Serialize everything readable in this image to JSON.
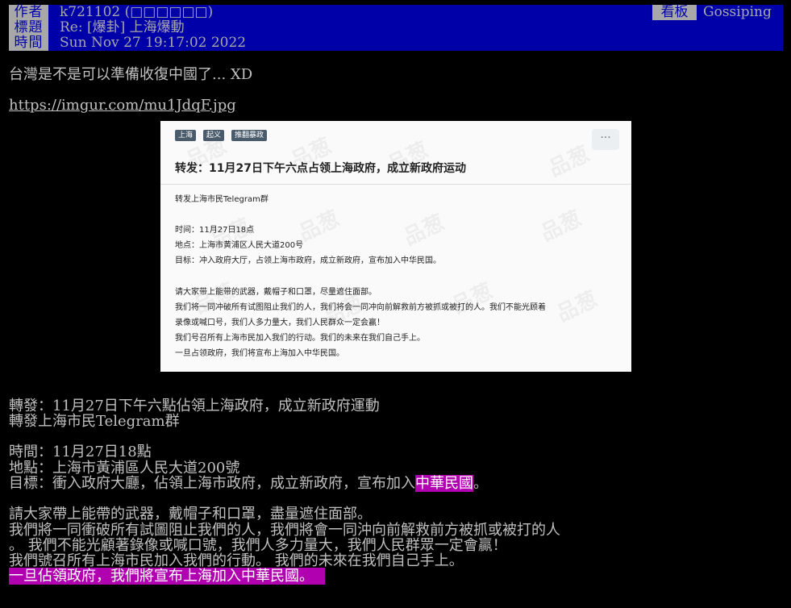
{
  "header": {
    "author_label": "作者",
    "author": "k721102 (□□□□□□)",
    "title_label": "標題",
    "title": "Re: [爆卦] 上海爆動",
    "time_label": "時間",
    "time": "Sun Nov 27 19:17:02 2022",
    "board_label": "看板",
    "board": "Gossiping"
  },
  "body": {
    "line1": "台灣是不是可以準備收復中國了... XD",
    "link": "https://imgur.com/mu1JdqF.jpg",
    "translation": [
      "轉發：11月27日下午六點佔領上海政府，成立新政府運動",
      "轉發上海市民Telegram群",
      "時間：11月27日18點",
      "地點：上海市黃浦區人民大道200號",
      "目標：衝入政府大廳，佔領上海市政府，成立新政府，宣布加入",
      "中華民國",
      "。",
      "請大家帶上能帶的武器，戴帽子和口罩，盡量遮住面部。",
      "我們將一同衝破所有試圖阻止我們的人，我們將會一同沖向前解救前方被抓或被打的人",
      "。  我們不能光顧著錄像或喊口號，我們人多力量大，我們人民群眾一定會贏！",
      "我們號召所有上海市民加入我們的行動。 我們的未來在我們自己手上。",
      "一旦佔領政府，我們將宣布上海加入中華民國。"
    ]
  },
  "image": {
    "tags": [
      "上海",
      "起义",
      "推翻暴政"
    ],
    "more": "···",
    "title": "转发：11月27日下午六点占领上海政府，成立新政府运动",
    "watermark": "品葱",
    "lines": [
      "转发上海市民Telegram群",
      "时间：11月27日18点",
      "地点：上海市黄浦区人民大道200号",
      "目标：冲入政府大厅，占领上海市政府，成立新政府，宣布加入中华民国。",
      "请大家带上能带的武器，戴帽子和口罩，尽量遮住面部。",
      "我们将一同冲破所有试图阻止我们的人，我们将会一同冲向前解救前方被抓或被打的人。我们不能光顾着",
      "录像或喊口号，我们人多力量大，我们人民群众一定会赢！",
      "我们号召所有上海市民加入我们的行动。我们的未来在我们自己手上。",
      "一旦占领政府，我们将宣布上海加入中华民国。"
    ]
  }
}
